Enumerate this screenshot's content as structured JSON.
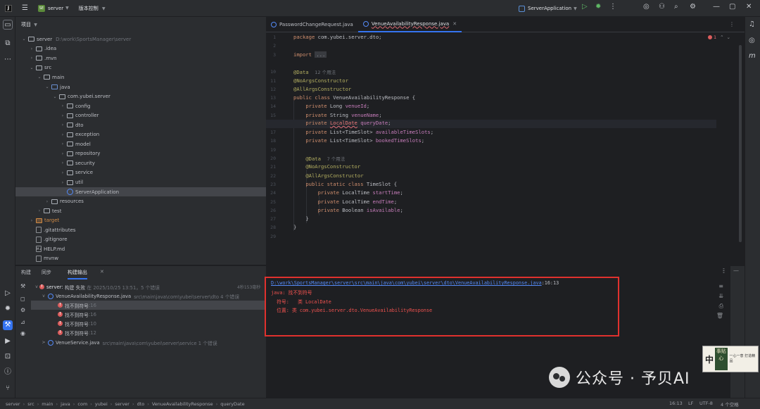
{
  "topbar": {
    "project_badge": "SE",
    "project_name": "server",
    "vcs_label": "版本控制",
    "run_config": "ServerApplication"
  },
  "project_panel": {
    "title": "项目",
    "tree": [
      {
        "label": "server",
        "hint": "D:\\work\\SportsManager\\server",
        "indent": 0,
        "arrow": "v",
        "icon": "folder"
      },
      {
        "label": ".idea",
        "indent": 1,
        "arrow": ">",
        "icon": "folder"
      },
      {
        "label": ".mvn",
        "indent": 1,
        "arrow": ">",
        "icon": "folder"
      },
      {
        "label": "src",
        "indent": 1,
        "arrow": "v",
        "icon": "folder"
      },
      {
        "label": "main",
        "indent": 2,
        "arrow": "v",
        "icon": "folder"
      },
      {
        "label": "java",
        "indent": 3,
        "arrow": "v",
        "icon": "folder-blue"
      },
      {
        "label": "com.yubei.server",
        "indent": 4,
        "arrow": "v",
        "icon": "pkg"
      },
      {
        "label": "config",
        "indent": 5,
        "arrow": ">",
        "icon": "pkg"
      },
      {
        "label": "controller",
        "indent": 5,
        "arrow": ">",
        "icon": "pkg"
      },
      {
        "label": "dto",
        "indent": 5,
        "arrow": ">",
        "icon": "pkg"
      },
      {
        "label": "exception",
        "indent": 5,
        "arrow": ">",
        "icon": "pkg"
      },
      {
        "label": "model",
        "indent": 5,
        "arrow": ">",
        "icon": "pkg"
      },
      {
        "label": "repository",
        "indent": 5,
        "arrow": ">",
        "icon": "pkg"
      },
      {
        "label": "security",
        "indent": 5,
        "arrow": ">",
        "icon": "pkg"
      },
      {
        "label": "service",
        "indent": 5,
        "arrow": ">",
        "icon": "pkg"
      },
      {
        "label": "util",
        "indent": 5,
        "arrow": ">",
        "icon": "pkg"
      },
      {
        "label": "ServerApplication",
        "indent": 5,
        "arrow": "",
        "icon": "class",
        "selected": true
      },
      {
        "label": "resources",
        "indent": 3,
        "arrow": ">",
        "icon": "folder"
      },
      {
        "label": "test",
        "indent": 2,
        "arrow": ">",
        "icon": "folder"
      },
      {
        "label": "target",
        "indent": 1,
        "arrow": ">",
        "icon": "folder-orange",
        "orange": true
      },
      {
        "label": ".gitattributes",
        "indent": 1,
        "arrow": "",
        "icon": "file"
      },
      {
        "label": ".gitignore",
        "indent": 1,
        "arrow": "",
        "icon": "file"
      },
      {
        "label": "HELP.md",
        "indent": 1,
        "arrow": "",
        "icon": "md"
      },
      {
        "label": "mvnw",
        "indent": 1,
        "arrow": "",
        "icon": "file"
      }
    ]
  },
  "editor": {
    "tabs": [
      {
        "label": "PasswordChangeRequest.java",
        "active": false
      },
      {
        "label": "VenueAvailabilityResponse.java",
        "active": true
      }
    ],
    "error_count": "1",
    "current_line": "16",
    "line_numbers": [
      "1",
      "2",
      "3",
      "",
      "",
      "",
      "",
      "",
      "",
      "10",
      "11",
      "12",
      "13",
      "14",
      "15",
      "16",
      "17",
      "18",
      "19",
      "20",
      "21",
      "22",
      "23",
      "24",
      "25",
      "26",
      "27",
      "28",
      "29"
    ],
    "code": {
      "l1_kw": "package",
      "l1_rest": " com.yubei.server.dto;",
      "l3_kw": "import",
      "l3_fold": "...",
      "l10_ann": "@Data",
      "l10_hint": "12 个用法",
      "l11_ann": "@NoArgsConstructor",
      "l12_ann": "@AllArgsConstructor",
      "l13_kw": "public class",
      "l13_rest": " VenueAvailabilityResponse {",
      "l14_kw": "private",
      "l14_type": " Long ",
      "l14_field": "venueId",
      "l14_end": ";",
      "l15_kw": "private",
      "l15_type": " String ",
      "l15_field": "venueName",
      "l15_end": ";",
      "l16_kw": "private",
      "l16_err": "LocalDate",
      "l16_field": " queryDate",
      "l16_end": ";",
      "l17_kw": "private",
      "l17_type": " List<TimeSlot> ",
      "l17_field": "availableTimeSlots",
      "l17_end": ";",
      "l18_kw": "private",
      "l18_type": " List<TimeSlot> ",
      "l18_field": "bookedTimeSlots",
      "l18_end": ";",
      "l20_ann": "@Data",
      "l20_hint": "7 个用法",
      "l21_ann": "@NoArgsConstructor",
      "l22_ann": "@AllArgsConstructor",
      "l23_kw": "public static class",
      "l23_rest": " TimeSlot {",
      "l24_kw": "private",
      "l24_type": " LocalTime ",
      "l24_field": "startTime",
      "l24_end": ";",
      "l25_kw": "private",
      "l25_type": " LocalTime ",
      "l25_field": "endTime",
      "l25_end": ";",
      "l26_kw": "private",
      "l26_type": " Boolean ",
      "l26_field": "isAvailable",
      "l26_end": ";",
      "l27": "}",
      "l28": "}"
    }
  },
  "bottom_panel": {
    "tabs": [
      "构建",
      "同步",
      "构建输出"
    ],
    "build_tree": {
      "root_label": "server:",
      "root_status": "构建 失败",
      "root_time": "在 2025/10/25 13:51，5 个错误",
      "root_duration": "4秒153毫秒",
      "file1": "VenueAvailabilityResponse.java",
      "file1_path": "src\\main\\java\\com\\yubei\\server\\dto 4 个错误",
      "errors": [
        {
          "label": "找不到符号",
          "line": ":16"
        },
        {
          "label": "找不到符号",
          "line": ":16"
        },
        {
          "label": "找不到符号",
          "line": ":10"
        },
        {
          "label": "找不到符号",
          "line": ":12"
        }
      ],
      "file2": "VenueService.java",
      "file2_path": "src\\main\\java\\com\\yubei\\server\\service 1 个错误"
    },
    "console": {
      "link": "D:\\work\\SportsManager\\server\\src\\main\\java\\com\\yubei\\server\\dto\\VenueAvailabilityResponse.java",
      "link_pos": ":16:13",
      "line2": "java: 找不到符号",
      "line3": "  符号:   类 LocalDate",
      "line4": "  位置: 类 com.yubei.server.dto.VenueAvailabilityResponse"
    }
  },
  "statusbar": {
    "crumbs": [
      "server",
      "src",
      "main",
      "java",
      "com",
      "yubei",
      "server",
      "dto",
      "VenueAvailabilityResponse",
      "queryDate"
    ],
    "position": "16:13",
    "line_sep": "LF",
    "encoding": "UTF-8",
    "indent": "4 个空格"
  },
  "watermark": {
    "text": "公众号 · 予贝AI",
    "seal_char": "中",
    "seal_box": "事贴心",
    "seal_small": "一心一意 打造精品"
  },
  "colors": {
    "accent": "#3574f0",
    "error": "#db5c5c",
    "highlight_box": "#e0312e"
  }
}
